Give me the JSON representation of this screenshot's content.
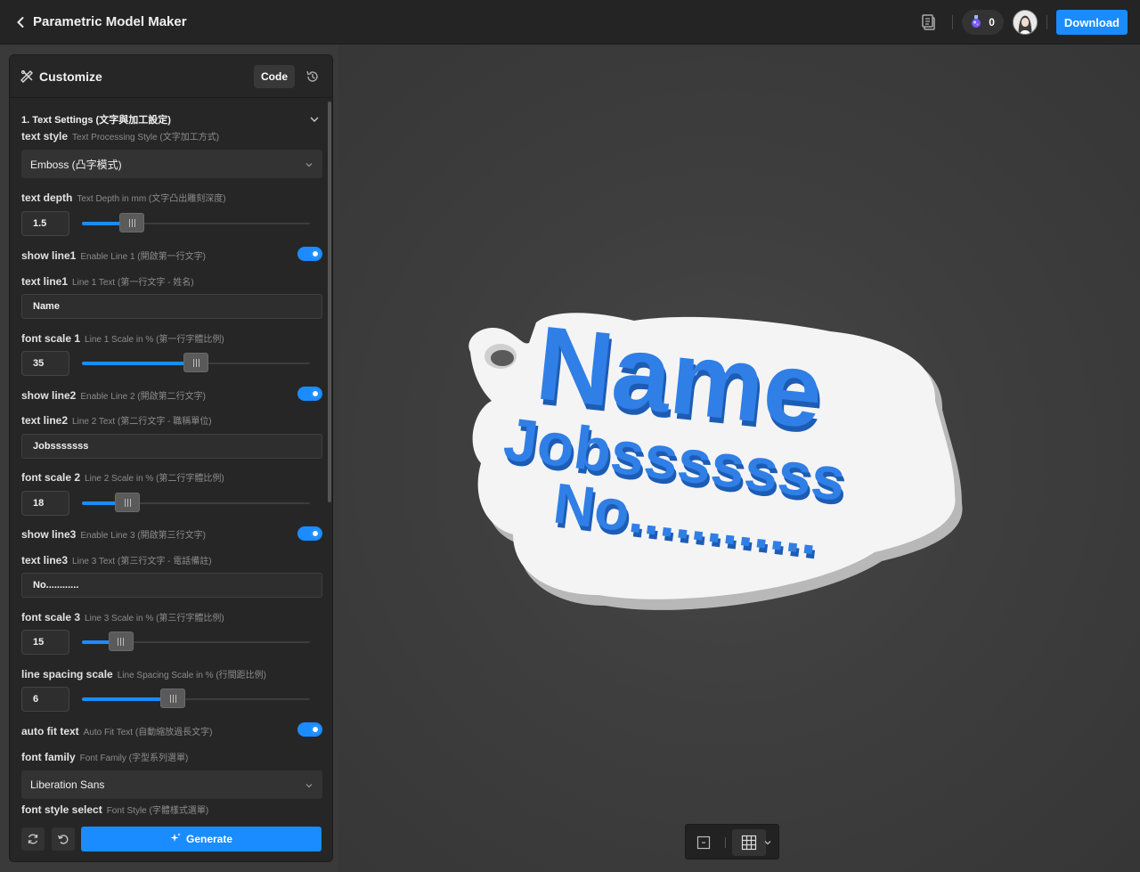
{
  "app": {
    "title": "Parametric Model Maker"
  },
  "header": {
    "credits": "0",
    "download_label": "Download"
  },
  "panel": {
    "title": "Customize",
    "code_label": "Code",
    "section_title": "1. Text Settings (文字與加工設定)",
    "fields": {
      "text_style": {
        "label": "text style",
        "desc": "Text Processing Style (文字加工方式)",
        "value": "Emboss (凸字模式)"
      },
      "text_depth": {
        "label": "text depth",
        "desc": "Text Depth in mm (文字凸出雕刻深度)",
        "value": "1.5",
        "level": 0.22
      },
      "show_line1": {
        "label": "show line1",
        "desc": "Enable Line 1 (開啟第一行文字)",
        "on": true
      },
      "text_line1": {
        "label": "text line1",
        "desc": "Line 1 Text (第一行文字 - 姓名)",
        "value": "Name"
      },
      "font_scale_1": {
        "label": "font scale 1",
        "desc": "Line 1 Scale in % (第一行字體比例)",
        "value": "35",
        "level": 0.5
      },
      "show_line2": {
        "label": "show line2",
        "desc": "Enable Line 2 (開啟第二行文字)",
        "on": true
      },
      "text_line2": {
        "label": "text line2",
        "desc": "Line 2 Text (第二行文字 - 職稱單位)",
        "value": "Jobsssssss"
      },
      "font_scale_2": {
        "label": "font scale 2",
        "desc": "Line 2 Scale in % (第二行字體比例)",
        "value": "18",
        "level": 0.2
      },
      "show_line3": {
        "label": "show line3",
        "desc": "Enable Line 3 (開啟第三行文字)",
        "on": true
      },
      "text_line3": {
        "label": "text line3",
        "desc": "Line 3 Text (第三行文字 - 電話備註)",
        "value": "No............"
      },
      "font_scale_3": {
        "label": "font scale 3",
        "desc": "Line 3 Scale in % (第三行字體比例)",
        "value": "15",
        "level": 0.17
      },
      "line_spacing": {
        "label": "line spacing scale",
        "desc": "Line Spacing Scale in % (行間距比例)",
        "value": "6",
        "level": 0.4
      },
      "auto_fit": {
        "label": "auto fit text",
        "desc": "Auto Fit Text (自動縮放過長文字)",
        "on": true
      },
      "font_family": {
        "label": "font family",
        "desc": "Font Family (字型系列選單)",
        "value": "Liberation Sans"
      },
      "font_style": {
        "label": "font style select",
        "desc": "Font Style (字體樣式選單)"
      }
    },
    "generate_label": "Generate"
  },
  "model": {
    "line1": "Name",
    "line2": "Jobsssssss",
    "line3": "No............",
    "text_color": "#2f7fe6",
    "base_color": "#f4f4f4"
  },
  "colors": {
    "accent": "#1a8cff",
    "topbar": "#242424",
    "panel": "#262626",
    "canvas": "#3e3e3e"
  }
}
